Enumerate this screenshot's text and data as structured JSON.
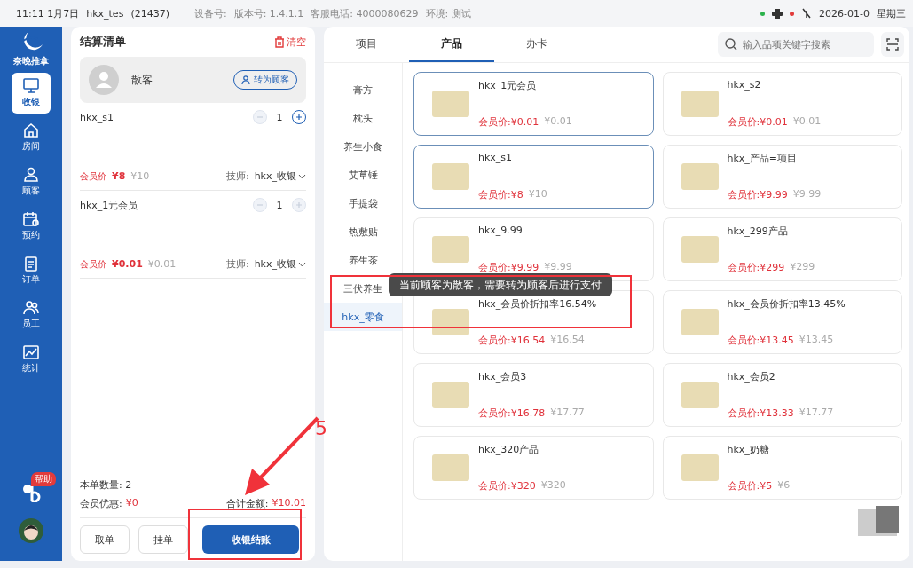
{
  "status_bar": {
    "time": "11:11 1月7日",
    "user": "hkx_tes",
    "user_id": "(21437)",
    "device": "设备号:",
    "version": "版本号: 1.4.1.1",
    "phone": "客服电话: 4000080629",
    "env": "环境: 测试",
    "date": "2026-01-0",
    "weekday": "星期三"
  },
  "sidebar": {
    "brand": "奈晚推拿",
    "help_badge": "帮助",
    "items": [
      {
        "label": "收银",
        "selected": true
      },
      {
        "label": "房间",
        "selected": false
      },
      {
        "label": "顾客",
        "selected": false
      },
      {
        "label": "预约",
        "selected": false
      },
      {
        "label": "订单",
        "selected": false
      },
      {
        "label": "员工",
        "selected": false
      },
      {
        "label": "统计",
        "selected": false
      }
    ]
  },
  "cart": {
    "title": "结算清单",
    "clear": "清空",
    "customer": {
      "name": "散客",
      "convert_button": "转为顾客"
    },
    "items": [
      {
        "name": "hkx_s1",
        "quantity": "1",
        "can_increase": true,
        "price_label": "会员价",
        "member_price": "¥8",
        "price": "¥10",
        "tech_label": "技师:",
        "tech": "hkx_收银"
      },
      {
        "name": "hkx_1元会员",
        "quantity": "1",
        "can_increase": false,
        "price_label": "会员价",
        "member_price": "¥0.01",
        "price": "¥0.01",
        "tech_label": "技师:",
        "tech": "hkx_收银"
      }
    ],
    "count": "本单数量: 2",
    "discount_label": "会员优惠:",
    "discount": "¥0",
    "total_label": "合计金额:",
    "total": "¥10.01",
    "buttons": [
      {
        "label": "取单",
        "kind": "secondary"
      },
      {
        "label": "挂单",
        "kind": "secondary"
      },
      {
        "label": "收银结账",
        "kind": "primary"
      }
    ]
  },
  "tabs": [
    {
      "label": "项目",
      "selected": false
    },
    {
      "label": "产品",
      "selected": true
    },
    {
      "label": "办卡",
      "selected": false
    }
  ],
  "search": {
    "placeholder": "输入品项关键字搜索"
  },
  "categories": [
    {
      "label": "膏方",
      "selected": false
    },
    {
      "label": "枕头",
      "selected": false
    },
    {
      "label": "养生小食",
      "selected": false
    },
    {
      "label": "艾草锤",
      "selected": false
    },
    {
      "label": "手提袋",
      "selected": false
    },
    {
      "label": "热敷贴",
      "selected": false
    },
    {
      "label": "养生茶",
      "selected": false
    },
    {
      "label": "三伏养生",
      "selected": false
    },
    {
      "label": "hkx_零食",
      "selected": true
    }
  ],
  "products": [
    {
      "name": "hkx_1元会员",
      "member_price": "会员价:¥0.01",
      "price": "¥0.01",
      "selected": true
    },
    {
      "name": "hkx_s2",
      "member_price": "会员价:¥0.01",
      "price": "¥0.01",
      "selected": false
    },
    {
      "name": "hkx_s1",
      "member_price": "会员价:¥8",
      "price": "¥10",
      "selected": true
    },
    {
      "name": "hkx_产品=项目",
      "member_price": "会员价:¥9.99",
      "price": "¥9.99",
      "selected": false
    },
    {
      "name": "hkx_9.99",
      "member_price": "会员价:¥9.99",
      "price": "¥9.99",
      "selected": false
    },
    {
      "name": "hkx_299产品",
      "member_price": "会员价:¥299",
      "price": "¥299",
      "selected": false
    },
    {
      "name": "hkx_会员价折扣率16.54%",
      "member_price": "会员价:¥16.54",
      "price": "¥16.54",
      "selected": false
    },
    {
      "name": "hkx_会员价折扣率13.45%",
      "member_price": "会员价:¥13.45",
      "price": "¥13.45",
      "selected": false
    },
    {
      "name": "hkx_会员3",
      "member_price": "会员价:¥16.78",
      "price": "¥17.77",
      "selected": false
    },
    {
      "name": "hkx_会员2",
      "member_price": "会员价:¥13.33",
      "price": "¥17.77",
      "selected": false
    },
    {
      "name": "hkx_320产品",
      "member_price": "会员价:¥320",
      "price": "¥320",
      "selected": false
    },
    {
      "name": "hkx_奶糖",
      "member_price": "会员价:¥5",
      "price": "¥6",
      "selected": false
    }
  ],
  "toast": "当前顾客为散客，需要转为顾客后进行支付",
  "annotation": {
    "number": "5"
  }
}
